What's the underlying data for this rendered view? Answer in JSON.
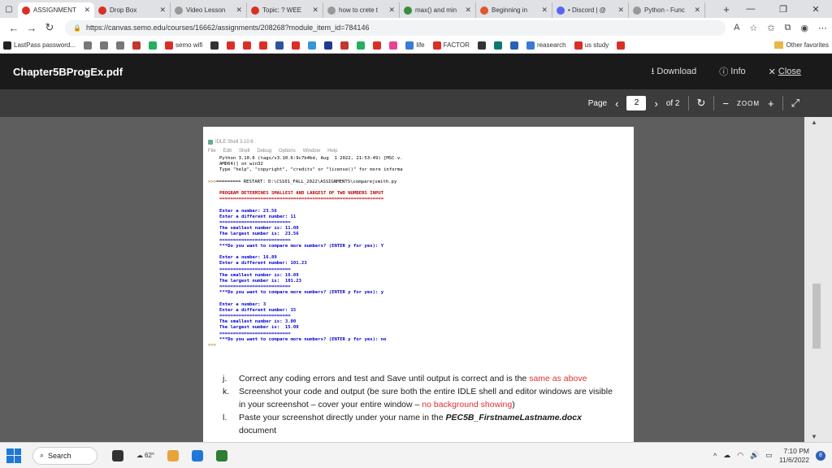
{
  "browser": {
    "tabs": [
      {
        "title": "ASSIGNMENT",
        "color": "#d93025",
        "active": true
      },
      {
        "title": "Drop Box",
        "color": "#d93025"
      },
      {
        "title": "Video Lesson",
        "color": "#999999"
      },
      {
        "title": "Topic: ? WEE",
        "color": "#d93025"
      },
      {
        "title": "how to crete t",
        "color": "#999999"
      },
      {
        "title": "max() and min",
        "color": "#3c8c3c"
      },
      {
        "title": "Beginning in",
        "color": "#e0572b"
      },
      {
        "title": "• Discord | @",
        "color": "#5865f2"
      },
      {
        "title": "Python - Func",
        "color": "#999999"
      }
    ],
    "new_tab": "+",
    "url": "https://canvas.semo.edu/courses/16662/assignments/208268?module_item_id=784146",
    "bookmarks": [
      {
        "label": "LastPass password...",
        "color": "#222222"
      },
      {
        "label": "",
        "color": "#777777"
      },
      {
        "label": "",
        "color": "#777777"
      },
      {
        "label": "",
        "color": "#777777"
      },
      {
        "label": "",
        "color": "#c0392b"
      },
      {
        "label": "",
        "color": "#27ae60"
      },
      {
        "label": "semo wifi",
        "color": "#d93025"
      },
      {
        "label": "",
        "color": "#333333"
      },
      {
        "label": "",
        "color": "#d93025"
      },
      {
        "label": "",
        "color": "#d93025"
      },
      {
        "label": "",
        "color": "#d93025"
      },
      {
        "label": "",
        "color": "#2b579a"
      },
      {
        "label": "",
        "color": "#d93025"
      },
      {
        "label": "",
        "color": "#3498db"
      },
      {
        "label": "",
        "color": "#1f3a93"
      },
      {
        "label": "",
        "color": "#c0392b"
      },
      {
        "label": "",
        "color": "#27ae60"
      },
      {
        "label": "",
        "color": "#d93025"
      },
      {
        "label": "",
        "color": "#e84393"
      },
      {
        "label": "life",
        "color": "#3a7bd5"
      },
      {
        "label": "FACTOR",
        "color": "#d93025"
      },
      {
        "label": "",
        "color": "#333333"
      },
      {
        "label": "",
        "color": "#0a7c6e"
      },
      {
        "label": "",
        "color": "#2a5fba"
      },
      {
        "label": "reasearch",
        "color": "#3a7bd5"
      },
      {
        "label": "us study",
        "color": "#d93025"
      },
      {
        "label": "",
        "color": "#d93025"
      }
    ],
    "other_favorites": "Other favorites"
  },
  "pdf": {
    "title": "Chapter5BProgEx.pdf",
    "download": "Download",
    "info": "Info",
    "close": "Close",
    "page_label": "Page",
    "page_current": "2",
    "page_total": "of 2",
    "zoom_label": "ZOOM"
  },
  "idle": {
    "window_title": "IDLE Shell 3.10.6",
    "menu": [
      "File",
      "Edit",
      "Shell",
      "Debug",
      "Options",
      "Window",
      "Help"
    ],
    "lines": [
      {
        "t": "Python 3.10.6 (tags/v3.10.6:9c7b4bd, Aug  1 2022, 21:53:49) [MSC v.",
        "k": "plain"
      },
      {
        "t": "AMD64)] on win32",
        "k": "plain"
      },
      {
        "t": "Type \"help\", \"copyright\", \"credits\" or \"license()\" for more informa",
        "k": "plain"
      },
      {
        "t": "",
        "k": "gap"
      },
      {
        "t": "========= RESTART: D:\\CS101_FALL_2022\\ASSIGNMENTS\\comparejsmith.py",
        "k": "plain",
        "p": ">>>"
      },
      {
        "t": "",
        "k": "gap"
      },
      {
        "t": "PROGRAM DETERMINES SMALLEST AND LARGEST OF TWO NUMBERS INPUT",
        "k": "red"
      },
      {
        "t": "============================================================",
        "k": "red"
      },
      {
        "t": "",
        "k": "gap"
      },
      {
        "t": "Enter a number: 23.56",
        "k": "blue"
      },
      {
        "t": "Enter a different number: 11",
        "k": "blue"
      },
      {
        "t": "==========================",
        "k": "blue"
      },
      {
        "t": "The smallest number is: 11.00",
        "k": "blue"
      },
      {
        "t": "The largest number is:  23.56",
        "k": "blue"
      },
      {
        "t": "==========================",
        "k": "blue"
      },
      {
        "t": "***Do you want to compare more numbers? (ENTER y for yes): Y",
        "k": "blue"
      },
      {
        "t": "",
        "k": "gap"
      },
      {
        "t": "Enter a number: 16.89",
        "k": "blue"
      },
      {
        "t": "Enter a different number: 101.23",
        "k": "blue"
      },
      {
        "t": "==========================",
        "k": "blue"
      },
      {
        "t": "The smallest number is: 16.89",
        "k": "blue"
      },
      {
        "t": "The largest number is:  101.23",
        "k": "blue"
      },
      {
        "t": "==========================",
        "k": "blue"
      },
      {
        "t": "***Do you want to compare more numbers? (ENTER y for yes): y",
        "k": "blue"
      },
      {
        "t": "",
        "k": "gap"
      },
      {
        "t": "Enter a number: 3",
        "k": "blue"
      },
      {
        "t": "Enter a different number: 15",
        "k": "blue"
      },
      {
        "t": "==========================",
        "k": "blue"
      },
      {
        "t": "The smallest number is: 3.00",
        "k": "blue"
      },
      {
        "t": "The largest number is:  15.00",
        "k": "blue"
      },
      {
        "t": "==========================",
        "k": "blue"
      },
      {
        "t": "***Do you want to compare more numbers? (ENTER y for yes): no",
        "k": "blue"
      },
      {
        "t": "",
        "k": "plain",
        "p": ">>>"
      }
    ]
  },
  "instructions": {
    "j_label": "j.",
    "j_text": "Correct any coding errors and test and Save until output is correct and is the",
    "j_red": "same as above",
    "k_label": "k.",
    "k_text": "Screenshot your code and output (be sure both the entire IDLE shell and editor windows are visible in your screenshot – cover your entire window –",
    "k_red": "no background showing",
    "k_end": ")",
    "l_label": "l.",
    "l_text": "Paste your screenshot directly under your name in the",
    "l_bold": "PEC5B_FirstnameLastname.docx",
    "l_end": "document"
  },
  "taskbar": {
    "search_label": "Search",
    "weather": "62°",
    "time": "7:10 PM",
    "date": "11/6/2022",
    "notification_count": "8"
  }
}
